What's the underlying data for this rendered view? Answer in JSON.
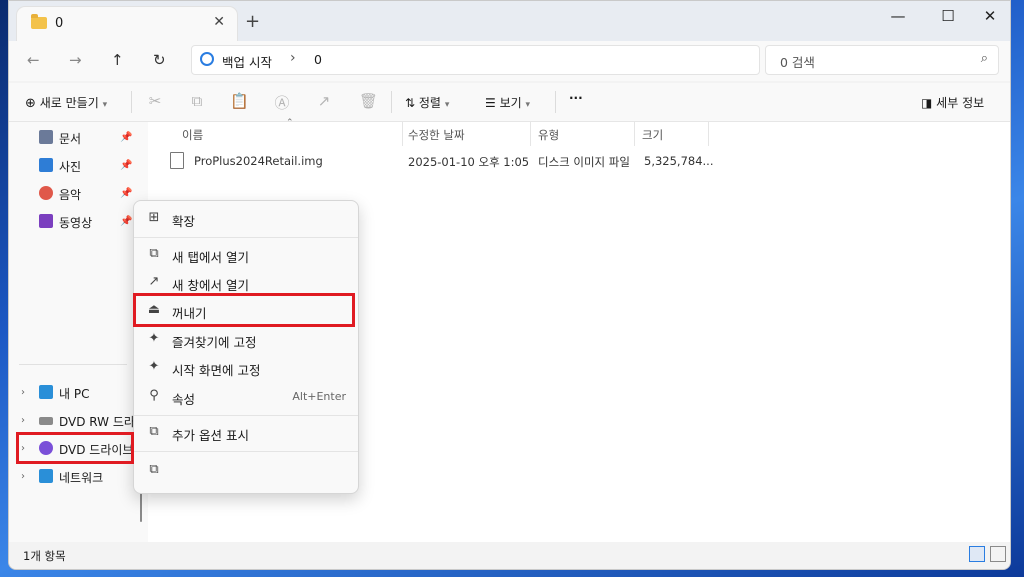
{
  "tab": {
    "title": "0",
    "close": "✕",
    "new": "+"
  },
  "window_controls": {
    "minimize": "—",
    "maximize": "☐",
    "close": "✕"
  },
  "address": {
    "crumb1": "백업 시작",
    "sep": "›",
    "crumb2": "0"
  },
  "search": {
    "placeholder": "0 검색"
  },
  "toolbar": {
    "new_label": "새로 만들기",
    "sort_label": "정렬",
    "view_label": "보기",
    "more": "···",
    "details_label": "세부 정보"
  },
  "sidebar": {
    "pinned": [
      {
        "label": "문서",
        "color": "#6b7a99"
      },
      {
        "label": "사진",
        "color": "#2e7dd6"
      },
      {
        "label": "음악",
        "color": "#e0584a"
      },
      {
        "label": "동영상",
        "color": "#7b3fbf"
      }
    ],
    "drives": [
      {
        "label": "내 PC",
        "color": "#2a8fd8"
      },
      {
        "label": "DVD RW 드라이",
        "color": "#8a8a8a"
      },
      {
        "label": "DVD 드라이브",
        "color": "#7a4fd8"
      },
      {
        "label": "네트워크",
        "color": "#2a8fd8"
      }
    ]
  },
  "columns": [
    "이름",
    "수정한 날짜",
    "유형",
    "크기"
  ],
  "files": [
    {
      "name": "ProPlus2024Retail.img",
      "date": "2025-01-10 오후 1:05",
      "type": "디스크 이미지 파일",
      "size": "5,325,784..."
    }
  ],
  "status": {
    "count": "1개 항목"
  },
  "context_menu": {
    "items": [
      {
        "icon": "⊞",
        "label": "확장",
        "shortcut": ""
      },
      {
        "icon": "⧉",
        "label": "새 탭에서 열기",
        "shortcut": ""
      },
      {
        "icon": "↗",
        "label": "새 창에서 열기",
        "shortcut": ""
      },
      {
        "icon": "⏏",
        "label": "꺼내기",
        "shortcut": ""
      },
      {
        "icon": "✦",
        "label": "즐겨찾기에 고정",
        "shortcut": ""
      },
      {
        "icon": "✦",
        "label": "시작 화면에 고정",
        "shortcut": ""
      },
      {
        "icon": "⚲",
        "label": "속성",
        "shortcut": "Alt+Enter"
      },
      {
        "icon": "⧉",
        "label": "추가 옵션 표시",
        "shortcut": ""
      }
    ],
    "copy_icon": "⧉"
  },
  "colors": {
    "highlight": "#e01b22",
    "accent": "#2a7de1"
  }
}
